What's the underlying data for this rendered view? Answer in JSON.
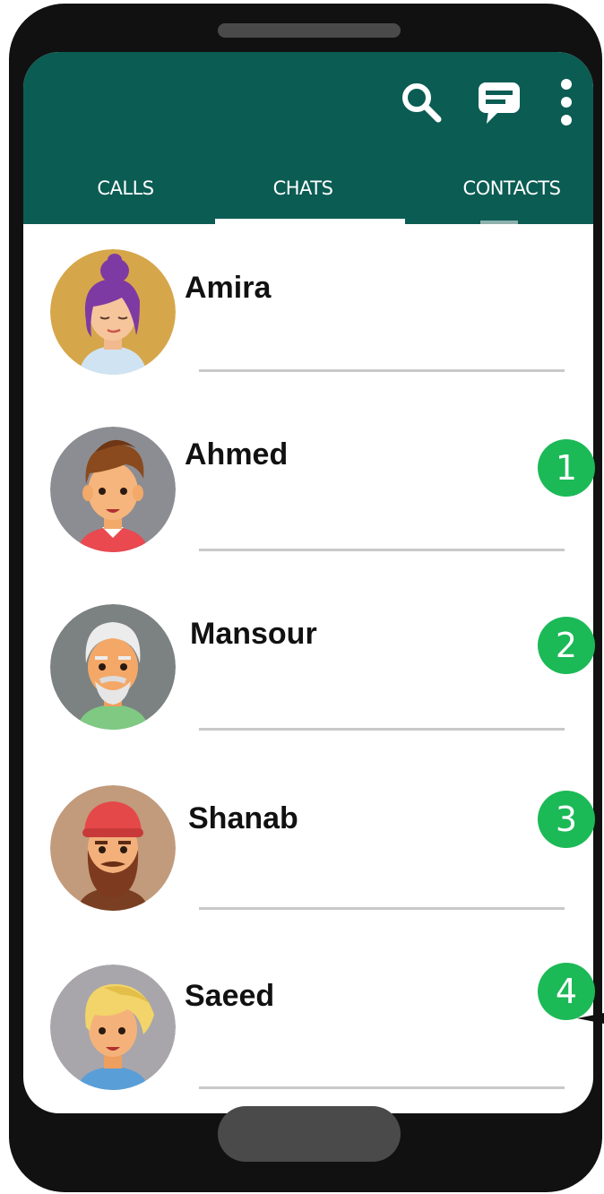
{
  "header": {
    "icons": [
      "search-icon",
      "new-chat-icon",
      "more-options-icon"
    ],
    "tabs": [
      {
        "label": "CALLS"
      },
      {
        "label": "CHATS",
        "selected": true
      },
      {
        "label": "CONTACTS"
      }
    ]
  },
  "chats": [
    {
      "name": "Amira",
      "avatar": "woman-purple-hair-avatar"
    },
    {
      "name": "Ahmed",
      "avatar": "man-brown-hair-avatar"
    },
    {
      "name": "Mansour",
      "avatar": "old-man-white-beard-avatar"
    },
    {
      "name": "Shanab",
      "avatar": "man-red-cap-beard-avatar"
    },
    {
      "name": "Saeed",
      "avatar": "boy-blond-hair-avatar"
    }
  ],
  "badges": [
    "1",
    "2",
    "3",
    "4"
  ],
  "colors": {
    "appbar": "#0b5c53",
    "badge": "#1cb957",
    "phone_frame": "#111111"
  }
}
